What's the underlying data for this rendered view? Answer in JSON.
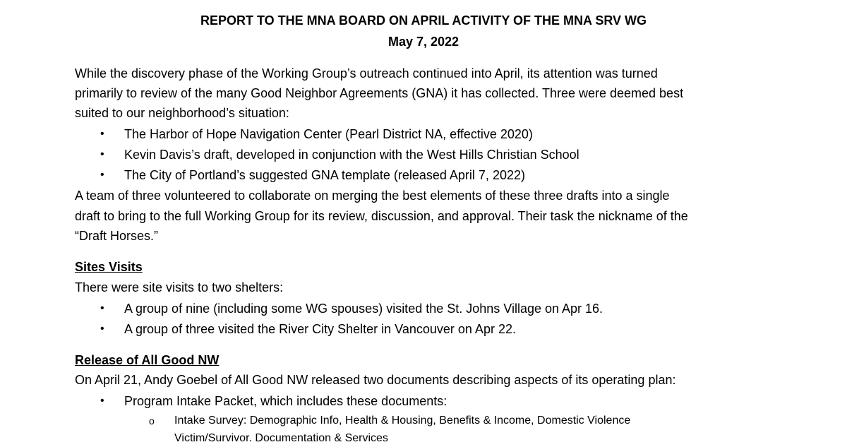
{
  "header": {
    "title": "REPORT TO THE MNA BOARD ON APRIL ACTIVITY OF THE MNA SRV WG",
    "date": "May 7, 2022"
  },
  "intro": {
    "lines": [
      "While the discovery phase of the Working Group’s outreach continued into April, its attention was turned",
      "primarily to review of the many Good Neighbor Agreements (GNA) it has collected. Three were deemed best",
      "suited to our neighborhood’s situation:"
    ],
    "bullets": [
      "The Harbor of Hope Navigation Center (Pearl District NA, effective 2020)",
      "Kevin Davis’s draft, developed in conjunction with the West Hills Christian School",
      "The City of Portland’s suggested GNA template (released April 7, 2022)"
    ],
    "after_lines": [
      "A team of three volunteered to collaborate on merging the best elements of these three drafts into a single",
      "draft to bring to the full Working Group for its review, discussion, and approval. Their task the nickname of the",
      "“Draft Horses.”"
    ]
  },
  "site_visits": {
    "heading": "Sites Visits",
    "intro": "There were site visits to two shelters:",
    "bullets": [
      "A group of nine (including some WG spouses) visited the St. Johns Village on Apr 16.",
      "A group of three visited the River City Shelter in Vancouver on Apr 22."
    ]
  },
  "release": {
    "heading": "Release of All Good NW",
    "intro": "On April 21, Andy Goebel of All Good NW released two documents describing aspects of its operating plan:",
    "bullet": "Program Intake Packet, which includes these documents:",
    "sub_bullet_lines": [
      "Intake Survey: Demographic Info, Health & Housing, Benefits & Income, Domestic Violence",
      "Victim/Survivor. Documentation & Services"
    ]
  },
  "glyphs": {
    "bullet": "•",
    "sub_bullet": "o"
  }
}
